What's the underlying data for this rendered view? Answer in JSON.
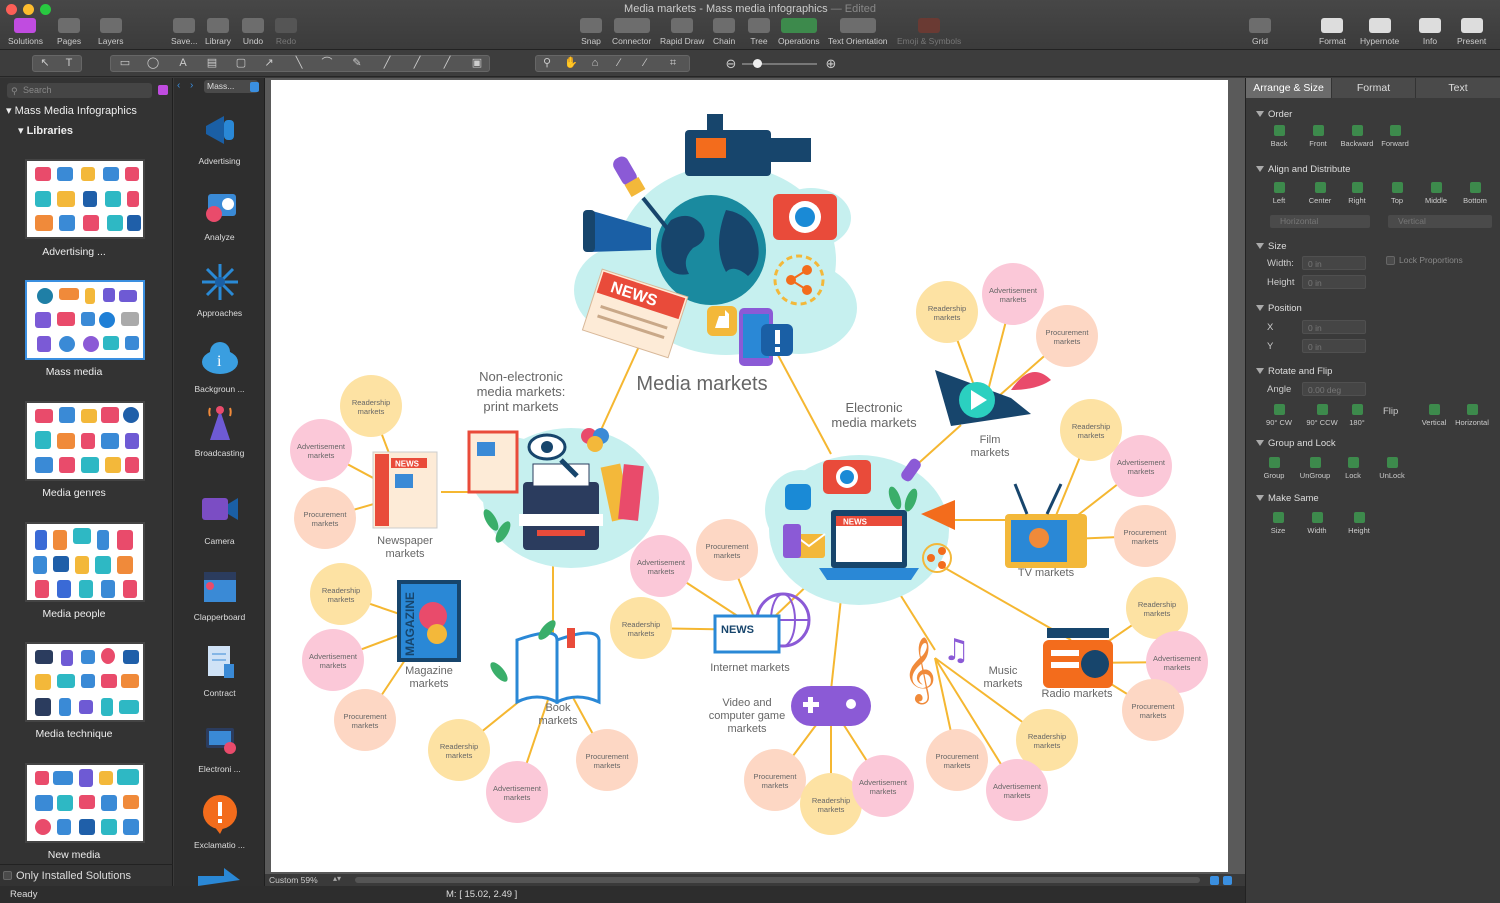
{
  "window": {
    "title": "Media markets - Mass media infographics",
    "edited": "— Edited"
  },
  "toolbar": {
    "solutions": "Solutions",
    "pages": "Pages",
    "layers": "Layers",
    "save": "Save...",
    "library": "Library",
    "undo": "Undo",
    "redo": "Redo",
    "snap": "Snap",
    "connector": "Connector",
    "rapid_draw": "Rapid Draw",
    "chain": "Chain",
    "tree": "Tree",
    "operations": "Operations",
    "text_orientation": "Text Orientation",
    "emoji": "Emoji & Symbols",
    "grid": "Grid",
    "format": "Format",
    "hypernote": "Hypernote",
    "info": "Info",
    "present": "Present"
  },
  "left": {
    "search_placeholder": "Search",
    "solution": "Mass Media Infographics",
    "libraries": "Libraries",
    "thumbs": [
      "Advertising ...",
      "Mass media",
      "Media genres",
      "Media people",
      "Media technique",
      "New media"
    ],
    "only_installed": "Only Installed Solutions"
  },
  "libcol": {
    "nav": "Mass...",
    "items": [
      "Advertising",
      "Analyze",
      "Approaches",
      "Backgroun ...",
      "Broadcasting",
      "Camera",
      "Clapperboard",
      "Contract",
      "Electroni ...",
      "Exclamatio ..."
    ]
  },
  "status": {
    "zoom": "Custom 59%",
    "ready": "Ready",
    "mouse": "M: [ 15.02, 2.49 ]"
  },
  "right": {
    "tabs": [
      "Arrange & Size",
      "Format",
      "Text"
    ],
    "order": "Order",
    "order_btns": [
      "Back",
      "Front",
      "Backward",
      "Forward"
    ],
    "align": "Align and Distribute",
    "align_btns": [
      "Left",
      "Center",
      "Right",
      "Top",
      "Middle",
      "Bottom"
    ],
    "horizontal": "Horizontal",
    "vertical": "Vertical",
    "size": "Size",
    "width": "Width:",
    "height": "Height",
    "w_val": "0 in",
    "h_val": "0 in",
    "lock": "Lock Proportions",
    "position": "Position",
    "x": "X",
    "y": "Y",
    "x_val": "0 in",
    "y_val": "0 in",
    "rotate": "Rotate and Flip",
    "angle": "Angle",
    "angle_val": "0.00 deg",
    "rot_btns": [
      "90° CW",
      "90° CCW",
      "180°"
    ],
    "flip": "Flip",
    "flip_btns": [
      "Vertical",
      "Horizontal"
    ],
    "group": "Group and Lock",
    "group_btns": [
      "Group",
      "UnGroup",
      "Lock",
      "UnLock"
    ],
    "same": "Make Same",
    "same_btns": [
      "Size",
      "Width",
      "Height"
    ]
  },
  "diagram": {
    "title": "Media markets",
    "nonelectronic": "Non-electronic media markets: print markets",
    "electronic": "Electronic media markets",
    "news_sign": "NEWS",
    "markets": {
      "newspaper": "Newspaper markets",
      "magazine": "Magazine markets",
      "book": "Book markets",
      "internet": "Internet markets",
      "video": "Video and computer game markets",
      "music": "Music markets",
      "radio": "Radio markets",
      "tv": "TV markets",
      "film": "Film markets"
    },
    "magazine_word": "MAGAZINE",
    "bubbles": {
      "readership": "Readership markets",
      "advertisement": "Advertisement markets",
      "procurement": "Procurement markets"
    },
    "colors": {
      "readership": "#fde2a3",
      "advertisement": "#fbc8d8",
      "procurement": "#fdd7c4",
      "line": "#f5b731",
      "blob": "#c6f0ef"
    }
  }
}
